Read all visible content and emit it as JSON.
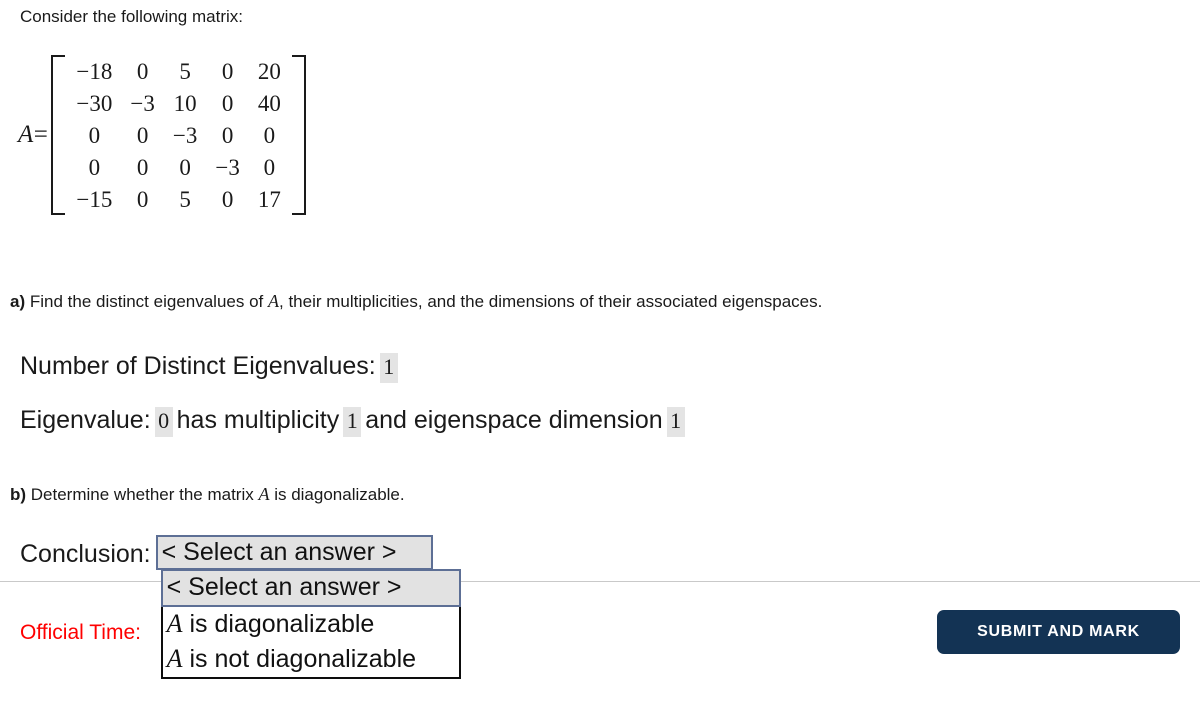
{
  "intro": "Consider the following matrix:",
  "matrix": {
    "label_var": "A",
    "label_eq": "=",
    "rows": [
      [
        "−18",
        "0",
        "5",
        "0",
        "20"
      ],
      [
        "−30",
        "−3",
        "10",
        "0",
        "40"
      ],
      [
        "0",
        "0",
        "−3",
        "0",
        "0"
      ],
      [
        "0",
        "0",
        "0",
        "−3",
        "0"
      ],
      [
        "−15",
        "0",
        "5",
        "0",
        "17"
      ]
    ]
  },
  "part_a": {
    "tag": "a)",
    "text_before_var": " Find the distinct eigenvalues of ",
    "var": "A",
    "text_after_var": ", their multiplicities, and the dimensions of their associated eigenspaces.",
    "count_label": "Number of Distinct Eigenvalues:",
    "count_value": "1",
    "eigen_label": "Eigenvalue:",
    "eigen_value": "0",
    "multiplicity_text": "has multiplicity",
    "multiplicity_value": "1",
    "dimension_text": "and eigenspace dimension",
    "dimension_value": "1"
  },
  "part_b": {
    "tag": "b)",
    "text_before_var": " Determine whether the matrix ",
    "var": "A",
    "text_after_var": " is diagonalizable.",
    "conclusion_label": "Conclusion:",
    "select_value": "< Select an answer >",
    "options": [
      {
        "var": "",
        "text": "< Select an answer >",
        "selected": true
      },
      {
        "var": "A",
        "text": " is diagonalizable",
        "selected": false
      },
      {
        "var": "A",
        "text": " is not diagonalizable",
        "selected": false
      }
    ]
  },
  "footer": {
    "official_time_label": "Official Time:",
    "official_time_color": "#ff0000",
    "submit_label": "SUBMIT AND MARK",
    "submit_color": "#133354"
  }
}
